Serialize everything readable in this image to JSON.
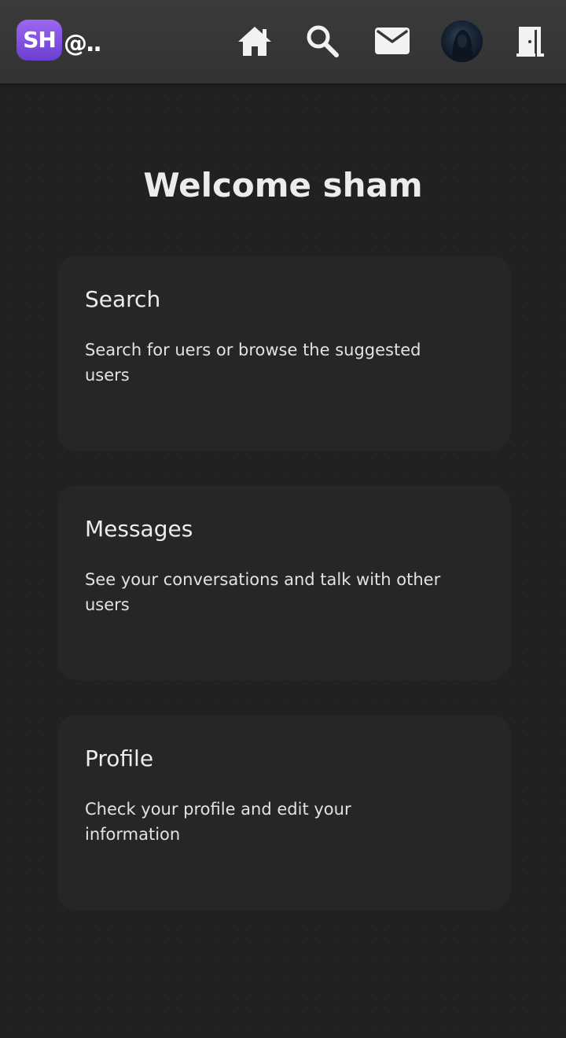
{
  "header": {
    "logo_text": "SH",
    "logo_tag": "@..",
    "icons": {
      "home": "home-icon",
      "search": "search-icon",
      "messages": "mail-icon",
      "profile": "avatar",
      "logout": "logout-door-icon"
    }
  },
  "main": {
    "title": "Welcome sham",
    "cards": [
      {
        "title": "Search",
        "description": "Search for uers or browse the suggested users"
      },
      {
        "title": "Messages",
        "description": "See your conversations and talk with other users"
      },
      {
        "title": "Profile",
        "description": "Check your profile and edit your information"
      }
    ]
  },
  "colors": {
    "background": "#212121",
    "header": "#363636",
    "card": "#262626",
    "logo_accent": "#8a55e8",
    "text": "#ececec"
  }
}
